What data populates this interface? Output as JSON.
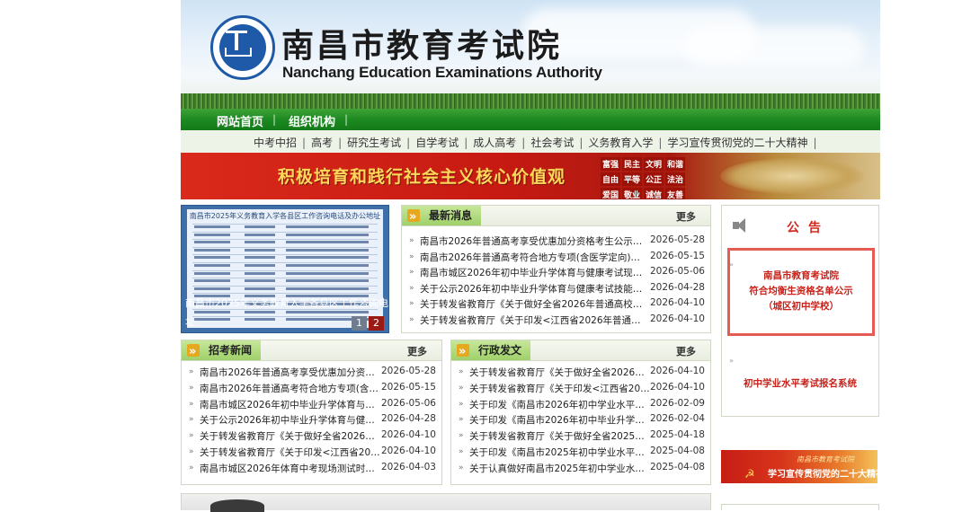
{
  "header": {
    "title_cn": "南昌市教育考试院",
    "title_en": "Nanchang Education Examinations Authority",
    "logo_icon": "emblem-icon"
  },
  "nav": {
    "items": [
      "网站首页",
      "组织机构"
    ]
  },
  "subnav": {
    "links": [
      "中考中招",
      "高考",
      "研究生考试",
      "自学考试",
      "成人高考",
      "社会考试",
      "义务教育入学",
      "学习宣传贯彻党的二十大精神"
    ]
  },
  "banner": {
    "slogan": "积极培育和践行社会主义核心价值观",
    "values": [
      "富强",
      "民主",
      "文明",
      "和谐",
      "自由",
      "平等",
      "公正",
      "法治",
      "爱国",
      "敬业",
      "诚信",
      "友善"
    ]
  },
  "slideshow": {
    "image_title": "南昌市2025年义务教育入学各县区工作咨询电话及办公地址",
    "caption": "南昌市2025年义务教育入学各县区工作咨询电话及办公地址",
    "caption_line2": "址",
    "pages": [
      "1",
      "2"
    ],
    "active_page": "2"
  },
  "latest_news": {
    "title": "最新消息",
    "more": "更多",
    "items": [
      {
        "title": "南昌市2026年普通高考享受优惠加分资格考生公示名单",
        "date": "2026-05-28"
      },
      {
        "title": "南昌市2026年普通高考符合地方专项(含医学定向)报考...",
        "date": "2026-05-15"
      },
      {
        "title": "南昌市城区2026年初中毕业升学体育与健康考试现场测试...",
        "date": "2026-05-06"
      },
      {
        "title": "关于公示2026年初中毕业升学体育与健康考试技能类选考...",
        "date": "2026-04-28"
      },
      {
        "title": "关于转发省教育厅《关于做好全省2026年普通高校招生享...",
        "date": "2026-04-10"
      },
      {
        "title": "关于转发省教育厅《关于印发<江西省2026年普通高校招...",
        "date": "2026-04-10"
      }
    ]
  },
  "admissions_news": {
    "title": "招考新闻",
    "more": "更多",
    "items": [
      {
        "title": "南昌市2026年普通高考享受优惠加分资格考...",
        "date": "2026-05-28"
      },
      {
        "title": "南昌市2026年普通高考符合地方专项(含医...",
        "date": "2026-05-15"
      },
      {
        "title": "南昌市城区2026年初中毕业升学体育与健康...",
        "date": "2026-05-06"
      },
      {
        "title": "关于公示2026年初中毕业升学体育与健康考...",
        "date": "2026-04-28"
      },
      {
        "title": "关于转发省教育厅《关于做好全省2026年普...",
        "date": "2026-04-10"
      },
      {
        "title": "关于转发省教育厅《关于印发<江西省2026...",
        "date": "2026-04-10"
      },
      {
        "title": "南昌市城区2026年体育中考现场测试时段电...",
        "date": "2026-04-03"
      }
    ]
  },
  "admin_docs": {
    "title": "行政发文",
    "more": "更多",
    "items": [
      {
        "title": "关于转发省教育厅《关于做好全省2026年普...",
        "date": "2026-04-10"
      },
      {
        "title": "关于转发省教育厅《关于印发<江西省2026...",
        "date": "2026-04-10"
      },
      {
        "title": "关于印发《南昌市2026年初中学业水平考试...",
        "date": "2026-02-09"
      },
      {
        "title": "关于印发《南昌市2026年初中毕业升学体育...",
        "date": "2026-02-04"
      },
      {
        "title": "关于转发省教育厅《关于做好全省2025年普...",
        "date": "2025-04-18"
      },
      {
        "title": "关于印发《南昌市2025年初中学业水平考试...",
        "date": "2025-04-08"
      },
      {
        "title": "关于认真做好南昌市2025年初中学业水平考...",
        "date": "2025-04-08"
      }
    ]
  },
  "notice": {
    "title": "公告",
    "box_lines": [
      "南昌市教育考试院",
      "符合均衡生资格名单公示",
      "（城区初中学校）"
    ],
    "link2": "初中学业水平考试报名系统",
    "bullet": "»"
  },
  "party_banner": {
    "top_text": "南昌市教育考试院",
    "text": "学习宣传贯彻党的二十大精神",
    "emblem": "☭"
  },
  "colors": {
    "nav_green": "#1d8a22",
    "notice_red": "#c8221a",
    "tab_green": "#9fd06a"
  }
}
